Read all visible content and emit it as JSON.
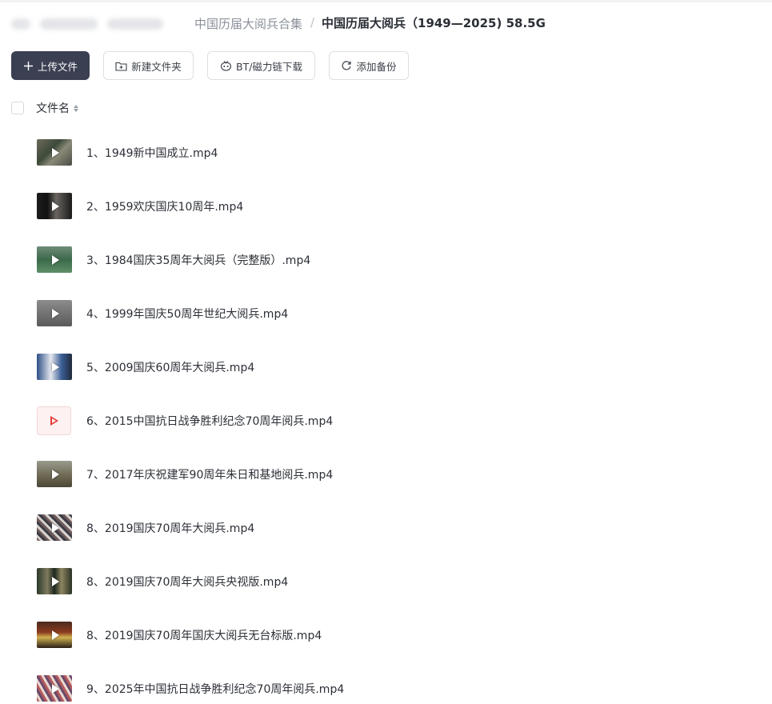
{
  "breadcrumb": {
    "parent": "中国历届大阅兵合集",
    "separator": "/",
    "current": "中国历届大阅兵（1949—2025) 58.5G"
  },
  "toolbar": {
    "upload_label": "上传文件",
    "new_folder_label": "新建文件夹",
    "bt_label": "BT/磁力链下载",
    "backup_label": "添加备份"
  },
  "list_header": {
    "name_column": "文件名"
  },
  "files": [
    {
      "name": "1、1949新中国成立.mp4",
      "thumb": "video-thumbnail"
    },
    {
      "name": "2、1959欢庆国庆10周年.mp4",
      "thumb": "video-thumbnail"
    },
    {
      "name": "3、1984国庆35周年大阅兵（完整版）.mp4",
      "thumb": "video-thumbnail"
    },
    {
      "name": "4、1999年国庆50周年世纪大阅兵.mp4",
      "thumb": "video-thumbnail"
    },
    {
      "name": "5、2009国庆60周年大阅兵.mp4",
      "thumb": "video-thumbnail"
    },
    {
      "name": "6、2015中国抗日战争胜利纪念70周年阅兵.mp4",
      "thumb": "video-file-icon"
    },
    {
      "name": "7、2017年庆祝建军90周年朱日和基地阅兵.mp4",
      "thumb": "video-thumbnail"
    },
    {
      "name": "8、2019国庆70周年大阅兵.mp4",
      "thumb": "video-thumbnail"
    },
    {
      "name": "8、2019国庆70周年大阅兵央视版.mp4",
      "thumb": "video-thumbnail"
    },
    {
      "name": "8、2019国庆70周年国庆大阅兵无台标版.mp4",
      "thumb": "video-thumbnail"
    },
    {
      "name": "9、2025年中国抗日战争胜利纪念70周年阅兵.mp4",
      "thumb": "video-thumbnail"
    }
  ],
  "colors": {
    "primary_button": "#3b3f52",
    "text": "#2b2f36",
    "muted": "#8a8f99",
    "video_icon_red": "#e53935"
  }
}
